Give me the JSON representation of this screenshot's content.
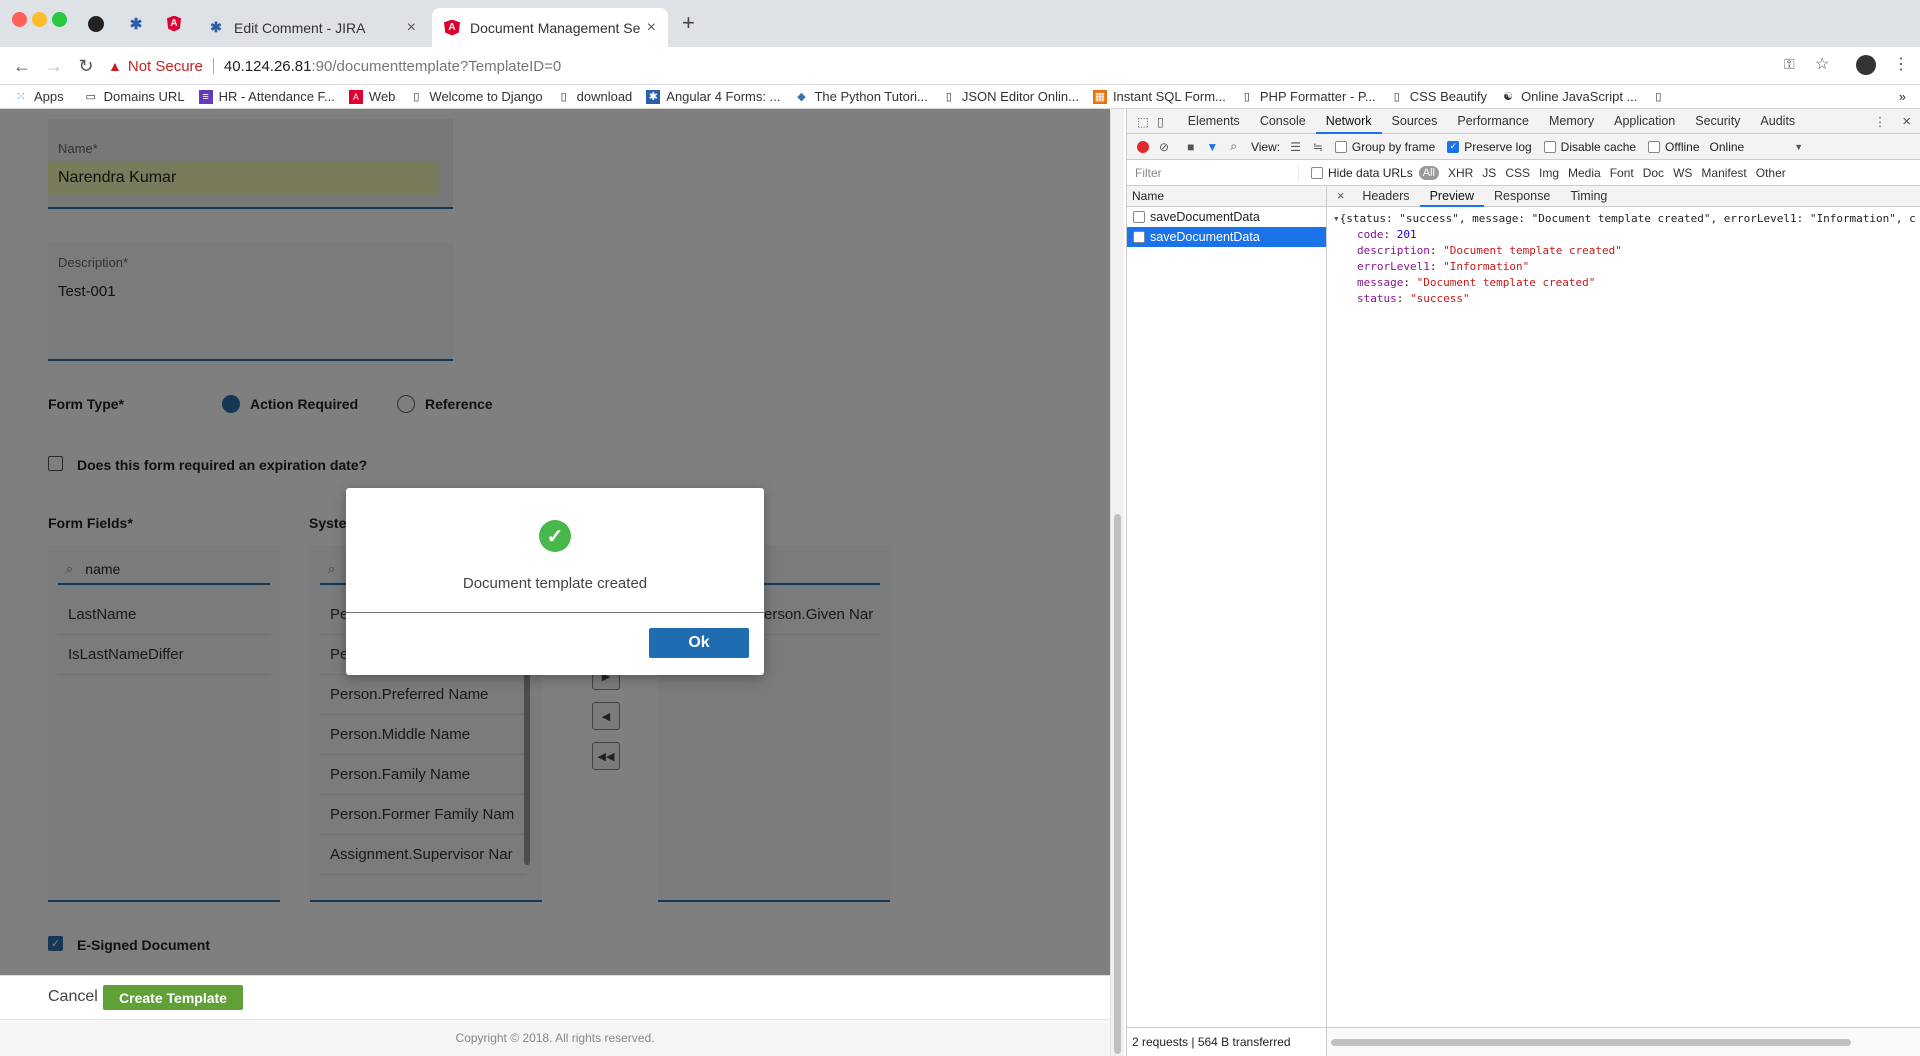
{
  "browser": {
    "tabs": [
      {
        "title": "Edit Comment - JIRA"
      },
      {
        "title": "Document Management Servic"
      }
    ],
    "new_tab": "+",
    "security_label": "Not Secure",
    "url_host": "40.124.26.81",
    "url_rest": ":90/documenttemplate?TemplateID=0",
    "bookmarks": [
      {
        "label": "Apps",
        "icon": "apps-grid-icon"
      },
      {
        "label": "Domains URL",
        "icon": "folder-icon"
      },
      {
        "label": "HR - Attendance F...",
        "icon": "form-icon"
      },
      {
        "label": "Web",
        "icon": "angular-icon"
      },
      {
        "label": "Welcome to Django",
        "icon": "page-icon"
      },
      {
        "label": "download",
        "icon": "page-icon"
      },
      {
        "label": "Angular 4 Forms: ...",
        "icon": "jira-icon"
      },
      {
        "label": "The Python Tutori...",
        "icon": "python-icon"
      },
      {
        "label": "JSON Editor Onlin...",
        "icon": "page-icon"
      },
      {
        "label": "Instant SQL Form...",
        "icon": "sql-icon"
      },
      {
        "label": "PHP Formatter - P...",
        "icon": "page-icon"
      },
      {
        "label": "CSS Beautify",
        "icon": "page-icon"
      },
      {
        "label": "Online JavaScript ...",
        "icon": "js-icon"
      }
    ],
    "more": "»"
  },
  "form": {
    "name_label": "Name*",
    "name_value": "Narendra Kumar",
    "description_label": "Description*",
    "description_value": "Test-001",
    "form_type_label": "Form Type*",
    "form_type_options": [
      "Action Required",
      "Reference"
    ],
    "form_type_selected": "Action Required",
    "expiration_label": "Does this form required an expiration date?",
    "form_fields_label": "Form Fields*",
    "system_fields_label": "Syster",
    "search_value": "name",
    "form_fields": [
      "LastName",
      "IsLastNameDiffer"
    ],
    "system_fields": [
      "Pe",
      "Pe",
      "Person.Preferred Name",
      "Person.Middle Name",
      "Person.Family Name",
      "Person.Former Family Nam",
      "Assignment.Supervisor Nar"
    ],
    "selected_fields": [
      "erson.Given Nar"
    ],
    "esigned_label": "E-Signed Document",
    "cancel_label": "Cancel",
    "create_label": "Create Template",
    "copyright": "Copyright © 2018. All rights reserved."
  },
  "modal": {
    "message": "Document template created",
    "ok_label": "Ok"
  },
  "devtools": {
    "tabs": [
      "Elements",
      "Console",
      "Network",
      "Sources",
      "Performance",
      "Memory",
      "Application",
      "Security",
      "Audits"
    ],
    "active_tab": "Network",
    "view_label": "View:",
    "group_by_frame": "Group by frame",
    "preserve_log": "Preserve log",
    "disable_cache": "Disable cache",
    "offline": "Offline",
    "throttle": "Online",
    "filter_placeholder": "Filter",
    "hide_data_urls": "Hide data URLs",
    "filter_types": [
      "All",
      "XHR",
      "JS",
      "CSS",
      "Img",
      "Media",
      "Font",
      "Doc",
      "WS",
      "Manifest",
      "Other"
    ],
    "name_header": "Name",
    "requests": [
      "saveDocumentData",
      "saveDocumentData"
    ],
    "detail_tabs": [
      "Headers",
      "Preview",
      "Response",
      "Timing"
    ],
    "active_detail": "Preview",
    "preview_summary": "{status: \"success\", message: \"Document template created\", errorLevel1: \"Information\", c",
    "preview_rows": [
      {
        "key": "code",
        "value": "201",
        "type": "num"
      },
      {
        "key": "description",
        "value": "\"Document template created\"",
        "type": "str"
      },
      {
        "key": "errorLevel1",
        "value": "\"Information\"",
        "type": "str"
      },
      {
        "key": "message",
        "value": "\"Document template created\"",
        "type": "str"
      },
      {
        "key": "status",
        "value": "\"success\"",
        "type": "str"
      }
    ],
    "status_bar": "2 requests | 564 B transferred"
  }
}
